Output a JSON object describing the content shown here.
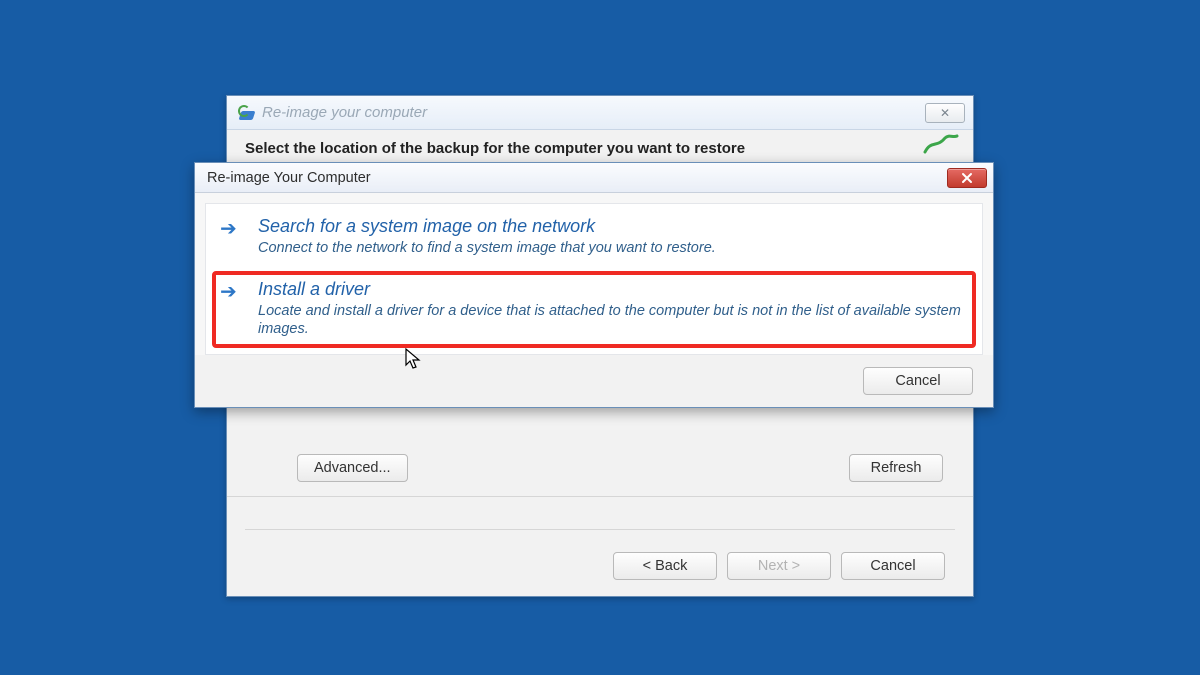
{
  "back_window": {
    "title": "Re-image your computer",
    "heading": "Select the location of the backup for the computer you want to restore",
    "buttons": {
      "advanced": "Advanced...",
      "refresh": "Refresh",
      "back": "< Back",
      "next": "Next >",
      "cancel": "Cancel"
    }
  },
  "front_dialog": {
    "title": "Re-image Your Computer",
    "options": [
      {
        "title": "Search for a system image on the network",
        "desc": "Connect to the network to find a system image that you want to restore."
      },
      {
        "title": "Install a driver",
        "desc": "Locate and install a driver for a device that is attached to the computer but is not in the list of available system images."
      }
    ],
    "cancel": "Cancel"
  }
}
